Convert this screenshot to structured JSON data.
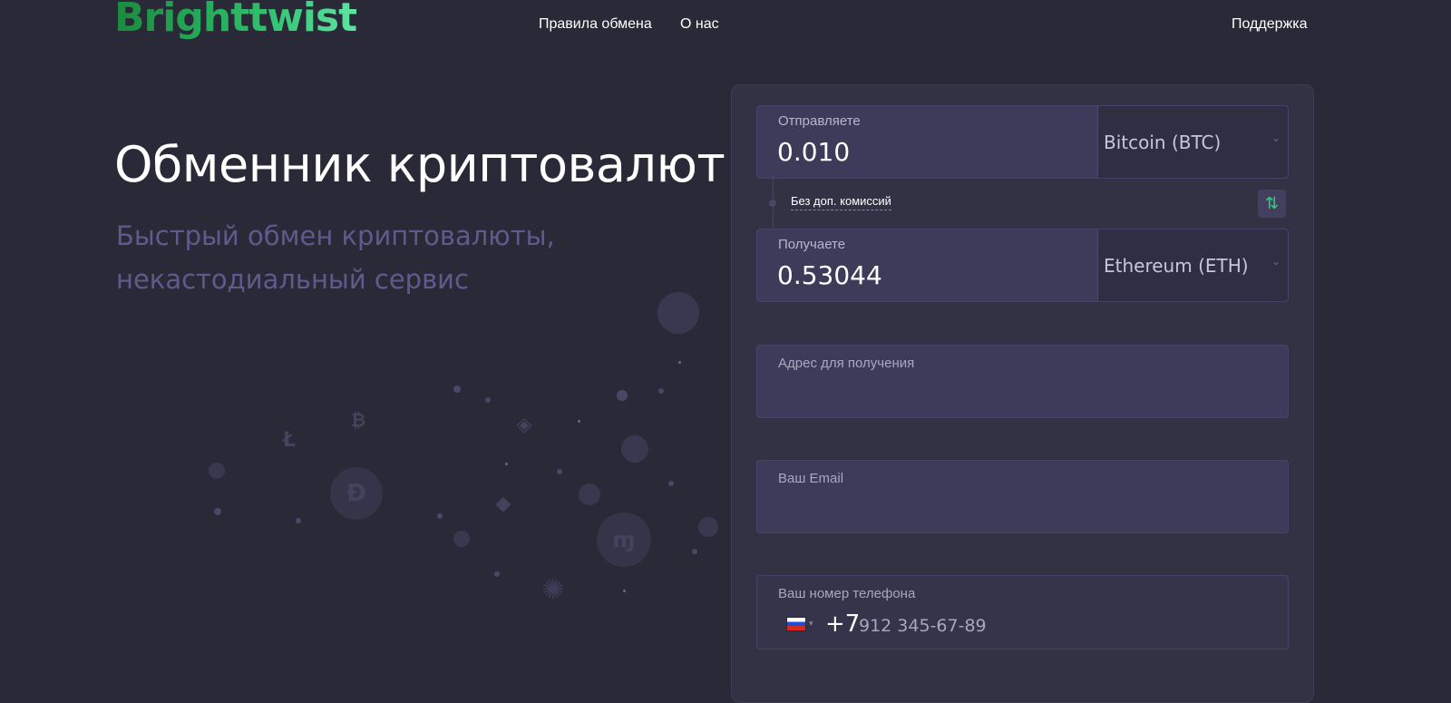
{
  "header": {
    "logo": "Brighttwist",
    "nav": [
      "Правила обмена",
      "О нас"
    ],
    "support": "Поддержка"
  },
  "hero": {
    "title": "Обменник криптовалют",
    "subtitle": "Быстрый обмен криптовалюты, некастодиальный сервис"
  },
  "exchange": {
    "send": {
      "label": "Отправляете",
      "amount": "0.010",
      "currency": "Bitcoin (BTC)"
    },
    "fee_note": "Без доп. комиссий",
    "swap_icon": "swap-arrows-icon",
    "receive": {
      "label": "Получаете",
      "amount": "0.53044",
      "currency": "Ethereum (ETH)"
    },
    "address_label": "Адрес для получения",
    "email_label": "Ваш Email",
    "phone": {
      "label": "Ваш номер телефона",
      "country_code": "+7",
      "placeholder": "912 345-67-89"
    }
  },
  "colors": {
    "background": "#2a2938",
    "panel": "#333244",
    "field": "#3d3b5a",
    "accent": "#2dbf6a",
    "subtitle": "#5f5a8c"
  }
}
